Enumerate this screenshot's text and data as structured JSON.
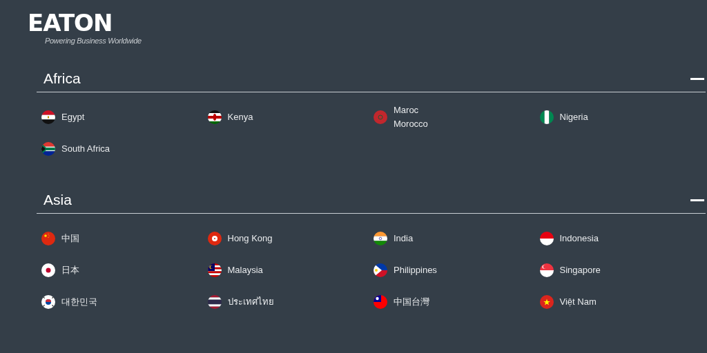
{
  "logo": {
    "wordmark": "EATON",
    "tagline": "Powering Business Worldwide"
  },
  "regions": [
    {
      "title": "Africa",
      "expanded": true,
      "countries": [
        {
          "kind": "egypt",
          "names": [
            "Egypt"
          ]
        },
        {
          "kind": "kenya",
          "names": [
            "Kenya"
          ]
        },
        {
          "kind": "morocco",
          "names": [
            "Maroc",
            "Morocco"
          ]
        },
        {
          "kind": "nigeria",
          "names": [
            "Nigeria"
          ]
        },
        {
          "kind": "southafrica",
          "names": [
            "South Africa"
          ]
        }
      ]
    },
    {
      "title": "Asia",
      "expanded": true,
      "countries": [
        {
          "kind": "china",
          "names": [
            "中国"
          ]
        },
        {
          "kind": "hongkong",
          "names": [
            "Hong Kong"
          ]
        },
        {
          "kind": "india",
          "names": [
            "India"
          ]
        },
        {
          "kind": "indonesia",
          "names": [
            "Indonesia"
          ]
        },
        {
          "kind": "japan",
          "names": [
            "日本"
          ]
        },
        {
          "kind": "malaysia",
          "names": [
            "Malaysia"
          ]
        },
        {
          "kind": "philippines",
          "names": [
            "Philippines"
          ]
        },
        {
          "kind": "singapore",
          "names": [
            "Singapore"
          ]
        },
        {
          "kind": "korea",
          "names": [
            "대한민국"
          ]
        },
        {
          "kind": "thailand",
          "names": [
            "ประเทศไทย"
          ]
        },
        {
          "kind": "taiwan",
          "names": [
            "中国台灣"
          ]
        },
        {
          "kind": "vietnam",
          "names": [
            "Việt Nam"
          ]
        }
      ]
    }
  ]
}
